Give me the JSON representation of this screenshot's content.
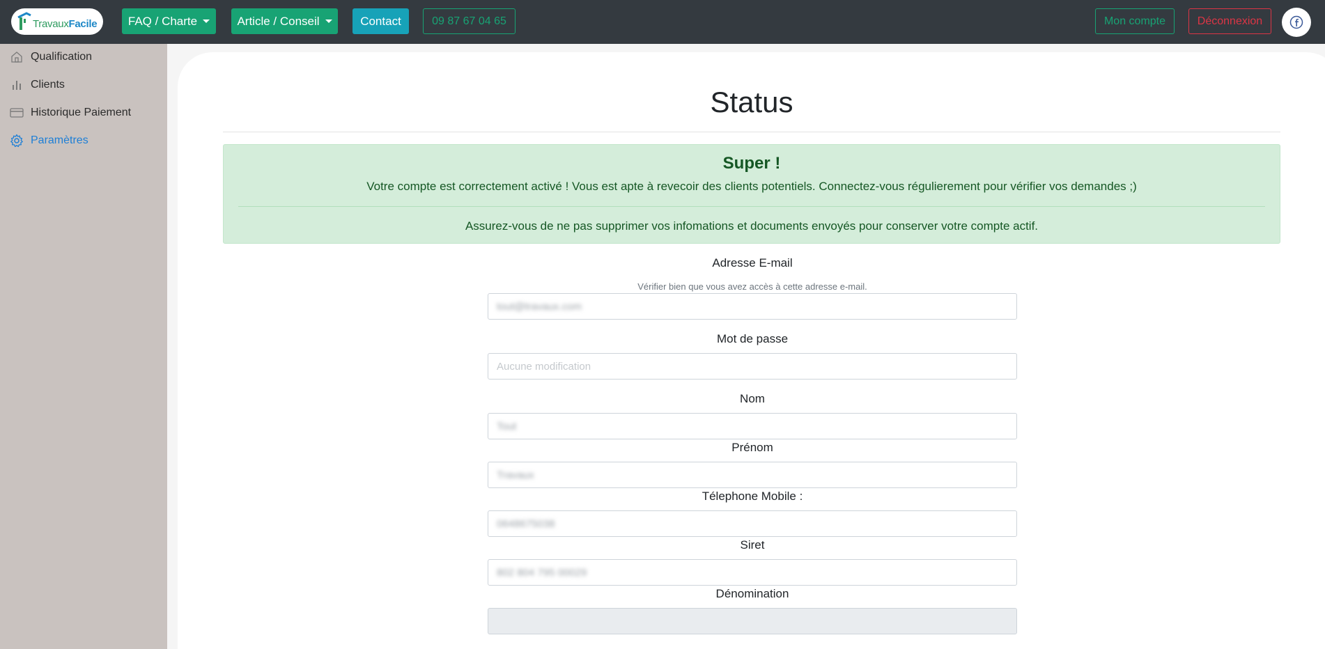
{
  "brand": {
    "part1": "Travaux",
    "part2": "Facile"
  },
  "nav": {
    "faq_label": "FAQ / Charte",
    "article_label": "Article / Conseil",
    "contact_label": "Contact",
    "phone": "09 87 67 04 65",
    "account_label": "Mon compte",
    "logout_label": "Déconnexion"
  },
  "sidebar": {
    "items": [
      {
        "label": "Qualification",
        "icon": "home-icon"
      },
      {
        "label": "Clients",
        "icon": "bar-chart-icon"
      },
      {
        "label": "Historique Paiement",
        "icon": "credit-card-icon"
      },
      {
        "label": "Paramètres",
        "icon": "gear-icon",
        "active": true
      }
    ]
  },
  "page": {
    "title": "Status",
    "alert": {
      "heading": "Super !",
      "message": "Votre compte est correctement activé ! Vous est apte à revecoir des clients potentiels. Connectez-vous régulierement pour vérifier vos demandes ;)",
      "note": "Assurez-vous de ne pas supprimer vos infomations et documents envoyés pour conserver votre compte actif."
    }
  },
  "form": {
    "email": {
      "label": "Adresse E-mail",
      "hint": "Vérifier bien que vous avez accès à cette adresse e-mail.",
      "value": "tout@travaux.com"
    },
    "password": {
      "label": "Mot de passe",
      "placeholder": "Aucune modification"
    },
    "nom": {
      "label": "Nom",
      "value": "Tout"
    },
    "prenom": {
      "label": "Prénom",
      "value": "Travaux"
    },
    "telephone": {
      "label": "Télephone Mobile :",
      "value": "0648675038"
    },
    "siret": {
      "label": "Siret",
      "value": "802 804 795 00029"
    },
    "denomination": {
      "label": "Dénomination",
      "value": ""
    }
  },
  "colors": {
    "navbar": "#343a40",
    "sidebar": "#c9c2bf",
    "green": "#18a374",
    "teal": "#17a2b8",
    "danger": "#dc3545",
    "active_link": "#1e7fd6",
    "alert_bg": "#d4edda"
  }
}
